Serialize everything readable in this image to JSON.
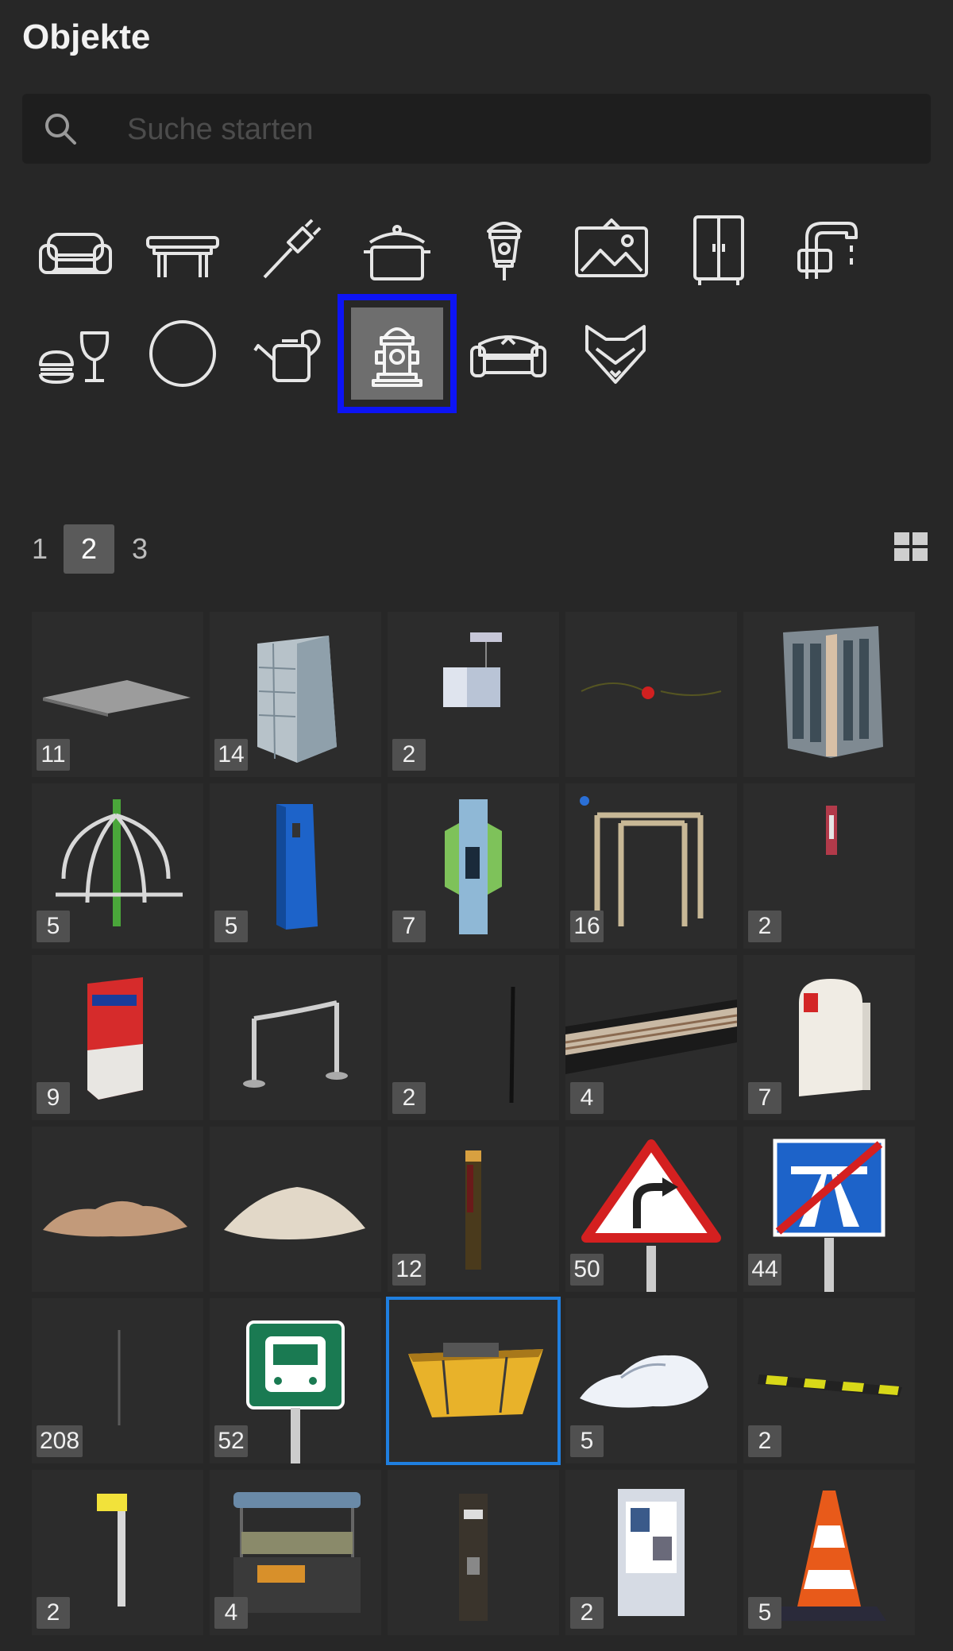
{
  "panel": {
    "title": "Objekte"
  },
  "search": {
    "placeholder": "Suche starten",
    "value": ""
  },
  "categories": [
    {
      "icon": "armchair-icon"
    },
    {
      "icon": "table-icon"
    },
    {
      "icon": "plug-icon"
    },
    {
      "icon": "cooking-pot-icon"
    },
    {
      "icon": "lantern-icon"
    },
    {
      "icon": "picture-icon"
    },
    {
      "icon": "wardrobe-icon"
    },
    {
      "icon": "faucet-icon"
    },
    {
      "icon": "food-drink-icon"
    },
    {
      "icon": "circle-icon"
    },
    {
      "icon": "watering-can-icon"
    },
    {
      "icon": "fire-hydrant-icon",
      "selected": true
    },
    {
      "icon": "sofa-icon"
    },
    {
      "icon": "fox-icon"
    }
  ],
  "pagination": {
    "pages": [
      "1",
      "2",
      "3"
    ],
    "current": "2"
  },
  "view_toggle": {
    "icon": "grid-view-icon"
  },
  "colors": {
    "background": "#272727",
    "category_selected_border": "#0d14f5",
    "tile_selected_border": "#1f7fe0"
  },
  "tiles": [
    {
      "name": "paving-plate",
      "count": "11"
    },
    {
      "name": "building-block",
      "count": "14"
    },
    {
      "name": "light-box",
      "count": "2"
    },
    {
      "name": "barrier-chain",
      "count": ""
    },
    {
      "name": "office-building",
      "count": ""
    },
    {
      "name": "playground-spinner",
      "count": "5"
    },
    {
      "name": "blue-pillar",
      "count": "5"
    },
    {
      "name": "info-column",
      "count": "7"
    },
    {
      "name": "climbing-frame",
      "count": "16"
    },
    {
      "name": "small-flag",
      "count": "2"
    },
    {
      "name": "red-box",
      "count": "9"
    },
    {
      "name": "rope-barrier",
      "count": ""
    },
    {
      "name": "thin-pole",
      "count": "2"
    },
    {
      "name": "rail-track",
      "count": "4"
    },
    {
      "name": "mailbox",
      "count": "7"
    },
    {
      "name": "dirt-pile",
      "count": ""
    },
    {
      "name": "sand-pile",
      "count": ""
    },
    {
      "name": "bollard-post",
      "count": "12"
    },
    {
      "name": "curve-warning-sign",
      "count": "50"
    },
    {
      "name": "motorway-end-sign",
      "count": "44"
    },
    {
      "name": "tall-pole",
      "count": "208"
    },
    {
      "name": "bus-stop-sign",
      "count": "52"
    },
    {
      "name": "dumpster",
      "count": "",
      "selected": true
    },
    {
      "name": "snow-pile",
      "count": "5"
    },
    {
      "name": "speed-bump",
      "count": "2"
    },
    {
      "name": "yellow-post",
      "count": "2"
    },
    {
      "name": "market-stall",
      "count": "4"
    },
    {
      "name": "parking-meter",
      "count": ""
    },
    {
      "name": "ticket-machine",
      "count": "2"
    },
    {
      "name": "traffic-cone",
      "count": "5"
    }
  ]
}
